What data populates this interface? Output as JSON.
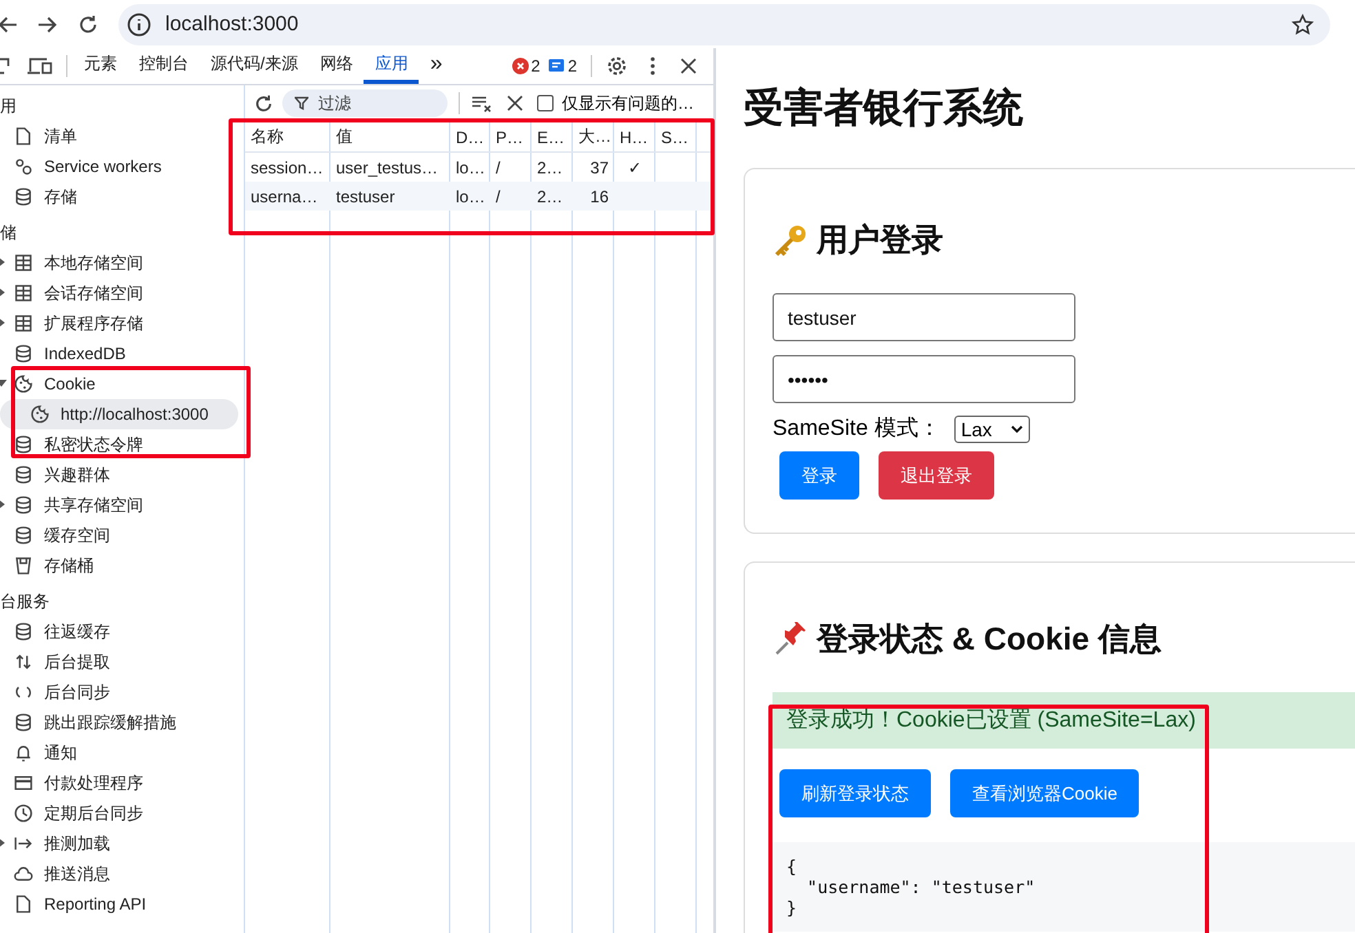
{
  "browser": {
    "address": "localhost:3000"
  },
  "devtools": {
    "tabs": [
      {
        "label": "元素",
        "selected": false
      },
      {
        "label": "控制台",
        "selected": false
      },
      {
        "label": "源代码/来源",
        "selected": false
      },
      {
        "label": "网络",
        "selected": false
      },
      {
        "label": "应用",
        "selected": true
      }
    ],
    "overflow": "»",
    "errors": "2",
    "messages": "2"
  },
  "sidebar": [
    {
      "title": "用",
      "items": [
        {
          "label": "清单",
          "kind": "file"
        },
        {
          "label": "Service workers",
          "kind": "gears"
        },
        {
          "label": "存储",
          "kind": "database"
        }
      ]
    },
    {
      "title": "储",
      "items": [
        {
          "label": "本地存储空间",
          "kind": "table",
          "expanded": false
        },
        {
          "label": "会话存储空间",
          "kind": "table",
          "expanded": false
        },
        {
          "label": "扩展程序存储",
          "kind": "table",
          "expanded": false
        },
        {
          "label": "IndexedDB",
          "kind": "database"
        },
        {
          "label": "Cookie",
          "kind": "cookie",
          "expanded": true,
          "children": [
            {
              "label": "http://localhost:3000",
              "kind": "cookie",
              "selected": true
            }
          ]
        },
        {
          "label": "私密状态令牌",
          "kind": "database"
        },
        {
          "label": "兴趣群体",
          "kind": "database"
        },
        {
          "label": "共享存储空间",
          "kind": "database",
          "expanded": false
        },
        {
          "label": "缓存空间",
          "kind": "database"
        },
        {
          "label": "存储桶",
          "kind": "bucket"
        }
      ]
    },
    {
      "title": "台服务",
      "items": [
        {
          "label": "往返缓存",
          "kind": "database"
        },
        {
          "label": "后台提取",
          "kind": "arrows"
        },
        {
          "label": "后台同步",
          "kind": "sync"
        },
        {
          "label": "跳出跟踪缓解措施",
          "kind": "database"
        },
        {
          "label": "通知",
          "kind": "bell"
        },
        {
          "label": "付款处理程序",
          "kind": "card"
        },
        {
          "label": "定期后台同步",
          "kind": "clock"
        },
        {
          "label": "推测加载",
          "kind": "arrow",
          "expanded": false
        },
        {
          "label": "推送消息",
          "kind": "cloud"
        },
        {
          "label": "Reporting API",
          "kind": "file"
        }
      ]
    }
  ],
  "cookies": {
    "filter": {
      "placeholder": "过滤"
    },
    "only_issues": {
      "label": "仅显示有问题的…",
      "checked": false
    },
    "columns": [
      "名称",
      "值",
      "D…",
      "P…",
      "E…",
      "大…",
      "H…",
      "S…"
    ],
    "rows": [
      [
        "session…",
        "user_testus…",
        "lo…",
        "/",
        "2…",
        "37",
        "✓",
        ""
      ],
      [
        "userna…",
        "testuser",
        "lo…",
        "/",
        "2…",
        "16",
        "",
        ""
      ]
    ]
  },
  "page": {
    "title": "受害者银行系统",
    "login": {
      "heading": "用户登录",
      "username": "testuser",
      "password": "••••••",
      "samesite_label": "SameSite 模式：",
      "samesite_value": "Lax",
      "buttons": [
        {
          "label": "登录",
          "kind": "primary"
        },
        {
          "label": "退出登录",
          "kind": "danger"
        }
      ]
    },
    "status": {
      "heading": "登录状态 & Cookie 信息",
      "alert": "登录成功！Cookie已设置 (SameSite=Lax)",
      "buttons": [
        {
          "label": "刷新登录状态",
          "kind": "primary"
        },
        {
          "label": "查看浏览器Cookie",
          "kind": "primary"
        }
      ],
      "json_lines": [
        "{",
        "  \"username\": \"testuser\"",
        "}"
      ]
    }
  }
}
